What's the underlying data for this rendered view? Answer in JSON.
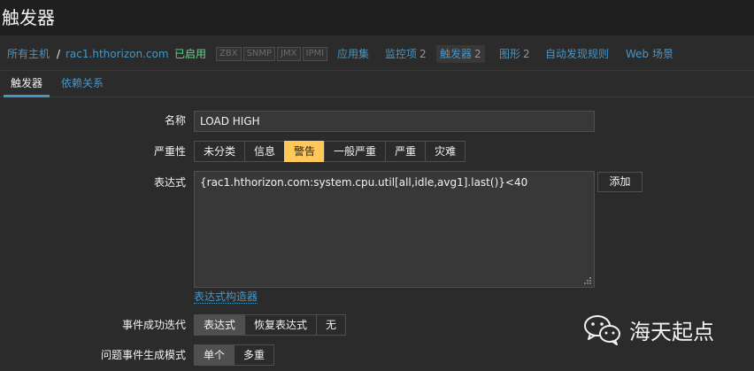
{
  "header": {
    "title": "触发器"
  },
  "nav": {
    "all_hosts": "所有主机",
    "separator": "/",
    "host": "rac1.hthorizon.com",
    "status": "已启用",
    "protocols": [
      "ZBX",
      "SNMP",
      "JMX",
      "IPMI"
    ],
    "applications": "应用集",
    "items": {
      "label": "监控项",
      "count": "2"
    },
    "triggers": {
      "label": "触发器",
      "count": "2"
    },
    "graphs": {
      "label": "图形",
      "count": "2"
    },
    "discovery": "自动发现规则",
    "web": "Web 场景"
  },
  "subtabs": {
    "trigger": "触发器",
    "dependencies": "依赖关系"
  },
  "form": {
    "name_label": "名称",
    "name_value": "LOAD HIGH",
    "severity_label": "严重性",
    "severity_options": [
      "未分类",
      "信息",
      "警告",
      "一般严重",
      "严重",
      "灾难"
    ],
    "severity_selected": "警告",
    "expression_label": "表达式",
    "expression_value": "{rac1.hthorizon.com:system.cpu.util[all,idle,avg1].last()}<40",
    "add_button": "添加",
    "expression_builder": "表达式构造器",
    "ok_event_label": "事件成功迭代",
    "ok_event_options": [
      "表达式",
      "恢复表达式",
      "无"
    ],
    "ok_event_selected": "表达式",
    "problem_mode_label": "问题事件生成模式",
    "problem_mode_options": [
      "单个",
      "多重"
    ],
    "problem_mode_selected": "单个"
  },
  "watermark": {
    "text": "海天起点",
    "icon": "wechat-icon"
  },
  "colors": {
    "accent": "#4796c4",
    "warning": "#ffc859",
    "enabled": "#59db8f",
    "background": "#2b2b2b"
  }
}
